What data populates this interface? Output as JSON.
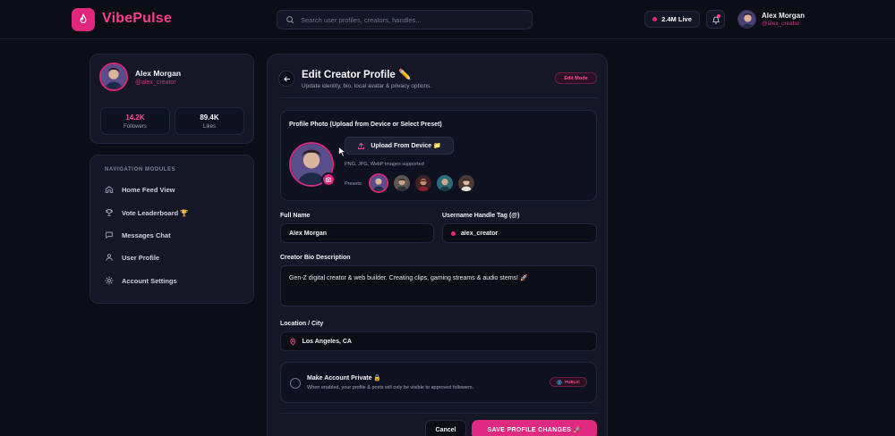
{
  "brand": {
    "name": "VibePulse",
    "accent": "#e0267d"
  },
  "search": {
    "placeholder": "Search user profiles, creators, handles..."
  },
  "header": {
    "live_label": "2.4M Live",
    "user_name": "Alex Morgan",
    "user_handle": "@alex_creator"
  },
  "profile_card": {
    "name": "Alex Morgan",
    "handle": "@alex_creator",
    "stats": [
      {
        "value": "14.2K",
        "label": "Followers"
      },
      {
        "value": "89.4K",
        "label": "Likes"
      }
    ]
  },
  "nav": {
    "title": "NAVIGATION MODULES",
    "items": [
      {
        "label": "Home Feed View",
        "icon": "home-icon"
      },
      {
        "label": "Vote Leaderboard 🏆",
        "icon": "trophy-icon"
      },
      {
        "label": "Messages Chat",
        "icon": "message-icon"
      },
      {
        "label": "User Profile",
        "icon": "user-icon"
      },
      {
        "label": "Account Settings",
        "icon": "gear-icon"
      }
    ]
  },
  "editor": {
    "title": "Edit Creator Profile ✏️",
    "subtitle": "Update identity, bio, local avatar & privacy options.",
    "mode_badge": "Edit Mode",
    "photo": {
      "title": "Profile Photo (Upload from Device or Select Preset)",
      "upload_label": "Upload From Device 📁",
      "formats_note": "PNG, JPG, WebP images supported",
      "presets_label": "Presets:"
    },
    "full_name": {
      "label": "Full Name",
      "value": "Alex Morgan"
    },
    "username": {
      "label": "Username Handle Tag (@)",
      "value": "alex_creator"
    },
    "bio": {
      "label": "Creator Bio Description",
      "value": "Gen-Z digital creator & web builder. Creating clips, gaming streams & audio stems! 🚀"
    },
    "location": {
      "label": "Location / City",
      "value": "Los Angeles, CA"
    },
    "privacy": {
      "title": "Make Account Private 🔒",
      "description": "When enabled, your profile & posts will only be visible to approved followers.",
      "badge": "PUBLIC"
    },
    "cancel_label": "Cancel",
    "save_label": "SAVE PROFILE CHANGES 🚀"
  }
}
